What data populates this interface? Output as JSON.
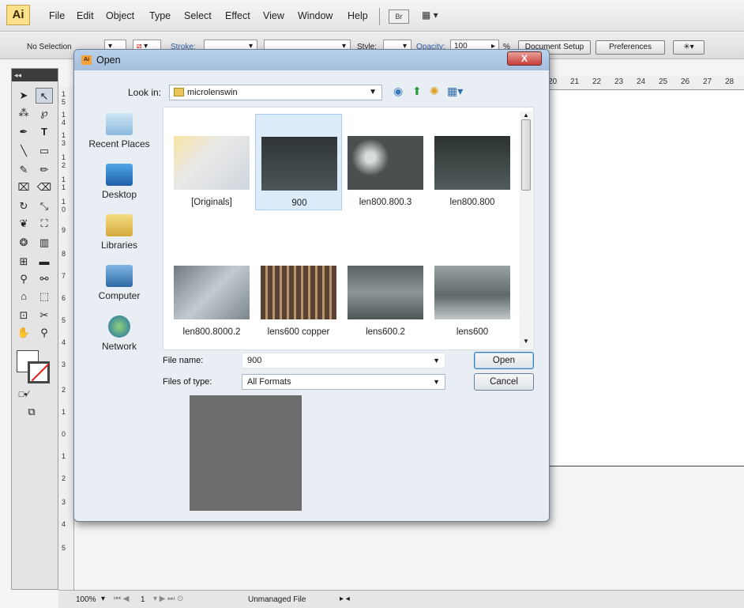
{
  "menubar": {
    "logo": "Ai",
    "items": [
      "File",
      "Edit",
      "Object",
      "Type",
      "Select",
      "Effect",
      "View",
      "Window",
      "Help"
    ],
    "bridge_label": "Br"
  },
  "control_bar": {
    "selection": "No Selection",
    "stroke_label": "Stroke:",
    "style_label": "Style:",
    "opacity_label": "Opacity:",
    "opacity_value": "100",
    "percent": "%",
    "document_setup": "Document Setup",
    "preferences": "Preferences"
  },
  "ruler": {
    "horizontal": [
      "20",
      "21",
      "22",
      "23",
      "24",
      "25",
      "26",
      "27",
      "28"
    ],
    "vertical": [
      "1",
      "5",
      "1",
      "4",
      "1",
      "3",
      "1",
      "2",
      "1",
      "1",
      "1",
      "0",
      "9",
      "8",
      "7",
      "6",
      "5",
      "4",
      "3",
      "2",
      "1",
      "0",
      "1",
      "2",
      "3",
      "4",
      "5"
    ]
  },
  "status_bar": {
    "zoom": "100%",
    "page": "1",
    "info": "Unmanaged File"
  },
  "dialog": {
    "title": "Open",
    "close": "X",
    "look_in_label": "Look in:",
    "look_in_value": "microlenswin",
    "places": [
      "Recent Places",
      "Desktop",
      "Libraries",
      "Computer",
      "Network"
    ],
    "files": [
      {
        "name": "[Originals]",
        "selected": false
      },
      {
        "name": "900",
        "selected": true
      },
      {
        "name": "len800.800.3",
        "selected": false
      },
      {
        "name": "len800.800",
        "selected": false
      },
      {
        "name": "len800.8000.2",
        "selected": false
      },
      {
        "name": "lens600 copper",
        "selected": false
      },
      {
        "name": "lens600.2",
        "selected": false
      },
      {
        "name": "lens600",
        "selected": false
      }
    ],
    "file_name_label": "File name:",
    "file_name_value": "900",
    "file_type_label": "Files of type:",
    "file_type_value": "All Formats",
    "open_button": "Open",
    "cancel_button": "Cancel"
  },
  "colors": {
    "titlebar": "#a9c3df",
    "close_button": "#c4413a",
    "selection": "#dcebfa"
  }
}
